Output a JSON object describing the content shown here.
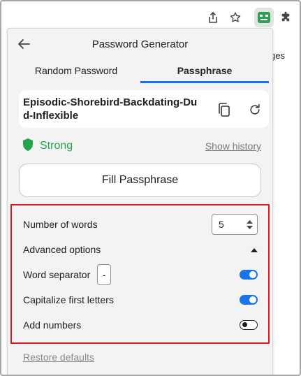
{
  "browser": {
    "behind_text": "ges"
  },
  "popup": {
    "title": "Password Generator",
    "tabs": [
      {
        "label": "Random Password"
      },
      {
        "label": "Passphrase"
      }
    ],
    "passphrase": "Episodic-Shorebird-Backdating-Dud-Inflexible",
    "strength": "Strong",
    "show_history": "Show history",
    "fill_button": "Fill Passphrase",
    "options": {
      "number_of_words_label": "Number of words",
      "number_of_words_value": "5",
      "advanced_label": "Advanced options",
      "word_separator_label": "Word separator",
      "word_separator_value": "-",
      "capitalize_label": "Capitalize first letters",
      "add_numbers_label": "Add numbers"
    },
    "restore_defaults": "Restore defaults"
  },
  "colors": {
    "accent": "#1a73e8",
    "strong": "#23a34d",
    "highlight": "#e0171b"
  }
}
